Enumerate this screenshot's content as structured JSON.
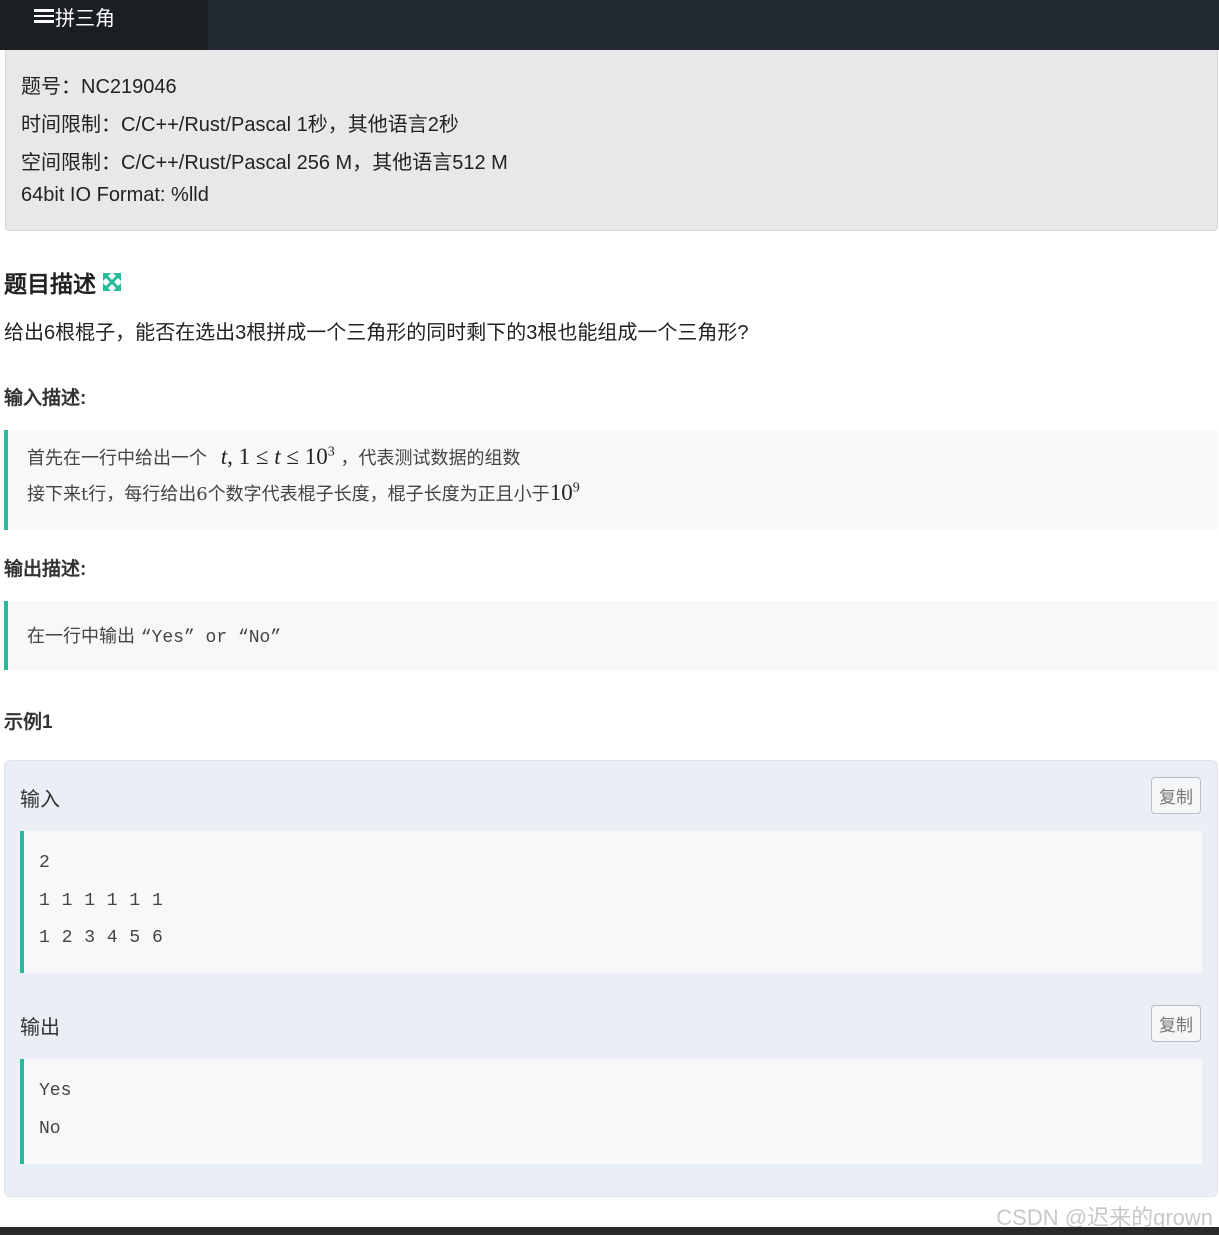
{
  "header": {
    "tab_title": "拼三角",
    "tab_icon": "list-icon"
  },
  "meta": {
    "problem_id": "题号：NC219046",
    "time_limit": "时间限制：C/C++/Rust/Pascal 1秒，其他语言2秒",
    "memory_limit": "空间限制：C/C++/Rust/Pascal 256 M，其他语言512 M",
    "io_format": "64bit IO Format: %lld"
  },
  "problem": {
    "title": "题目描述",
    "description": "给出6根棍子，能否在选出3根拼成一个三角形的同时剩下的3根也能组成一个三角形?"
  },
  "input_section": {
    "heading": "输入描述:",
    "line1_prefix": "首先在一行中给出一个",
    "line1_math_t": "t",
    "line1_math_mid": ", 1 ≤ ",
    "line1_math_t2": "t",
    "line1_math_le": " ≤ 10",
    "line1_math_exp": "3",
    "line1_suffix": "，代表测试数据的组数",
    "line2_prefix": "接下来t行，每行给出6个数字代表棍子长度，棍子长度为正且小于",
    "line2_math": "10",
    "line2_math_exp": "9"
  },
  "output_section": {
    "heading": "输出描述:",
    "text_prefix": "在一行中输出 ",
    "text_quoted": "“Yes” or “No”"
  },
  "example": {
    "heading": "示例1",
    "input_label": "输入",
    "output_label": "输出",
    "copy_label": "复制",
    "input_lines": [
      "2",
      "1 1 1 1 1 1",
      "1 2 3 4 5 6"
    ],
    "output_lines": [
      "Yes",
      "No"
    ]
  },
  "colors": {
    "accent": "#25bb9b",
    "topbar": "#232930"
  },
  "watermark": "CSDN @迟来的grown"
}
